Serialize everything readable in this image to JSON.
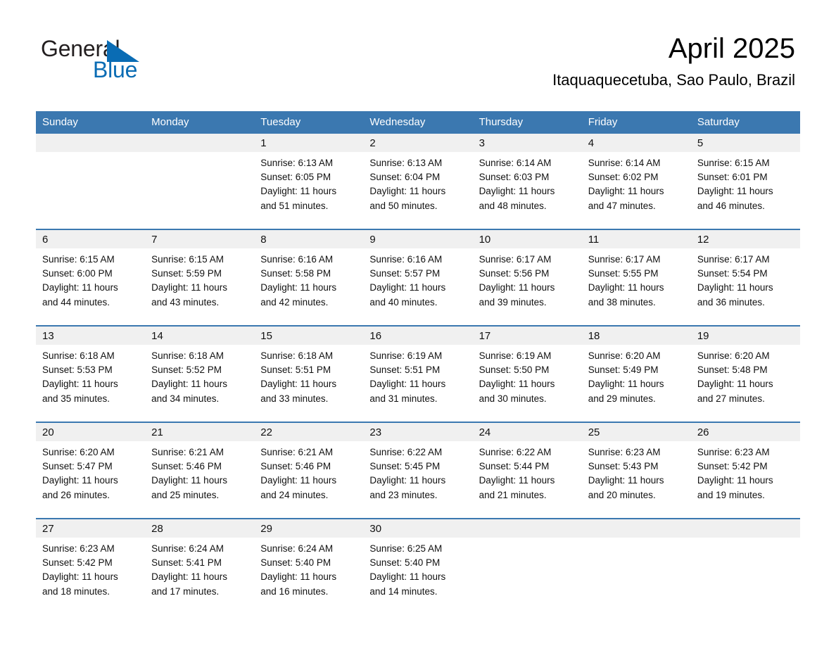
{
  "brand": {
    "name_part1": "General",
    "name_part2": "Blue",
    "triangle_color": "#0a6cb4"
  },
  "header": {
    "title": "April 2025",
    "subtitle": "Itaquaquecetuba, Sao Paulo, Brazil"
  },
  "theme": {
    "header_blue": "#3b78b0",
    "daynum_band": "#f0f0f0",
    "text": "#111111",
    "page_bg": "#ffffff"
  },
  "calendar": {
    "weekday_headers": [
      "Sunday",
      "Monday",
      "Tuesday",
      "Wednesday",
      "Thursday",
      "Friday",
      "Saturday"
    ],
    "weeks": [
      [
        {
          "day": "",
          "sunrise": "",
          "sunset": "",
          "daylight_line1": "",
          "daylight_line2": ""
        },
        {
          "day": "",
          "sunrise": "",
          "sunset": "",
          "daylight_line1": "",
          "daylight_line2": ""
        },
        {
          "day": "1",
          "sunrise": "Sunrise: 6:13 AM",
          "sunset": "Sunset: 6:05 PM",
          "daylight_line1": "Daylight: 11 hours",
          "daylight_line2": "and 51 minutes."
        },
        {
          "day": "2",
          "sunrise": "Sunrise: 6:13 AM",
          "sunset": "Sunset: 6:04 PM",
          "daylight_line1": "Daylight: 11 hours",
          "daylight_line2": "and 50 minutes."
        },
        {
          "day": "3",
          "sunrise": "Sunrise: 6:14 AM",
          "sunset": "Sunset: 6:03 PM",
          "daylight_line1": "Daylight: 11 hours",
          "daylight_line2": "and 48 minutes."
        },
        {
          "day": "4",
          "sunrise": "Sunrise: 6:14 AM",
          "sunset": "Sunset: 6:02 PM",
          "daylight_line1": "Daylight: 11 hours",
          "daylight_line2": "and 47 minutes."
        },
        {
          "day": "5",
          "sunrise": "Sunrise: 6:15 AM",
          "sunset": "Sunset: 6:01 PM",
          "daylight_line1": "Daylight: 11 hours",
          "daylight_line2": "and 46 minutes."
        }
      ],
      [
        {
          "day": "6",
          "sunrise": "Sunrise: 6:15 AM",
          "sunset": "Sunset: 6:00 PM",
          "daylight_line1": "Daylight: 11 hours",
          "daylight_line2": "and 44 minutes."
        },
        {
          "day": "7",
          "sunrise": "Sunrise: 6:15 AM",
          "sunset": "Sunset: 5:59 PM",
          "daylight_line1": "Daylight: 11 hours",
          "daylight_line2": "and 43 minutes."
        },
        {
          "day": "8",
          "sunrise": "Sunrise: 6:16 AM",
          "sunset": "Sunset: 5:58 PM",
          "daylight_line1": "Daylight: 11 hours",
          "daylight_line2": "and 42 minutes."
        },
        {
          "day": "9",
          "sunrise": "Sunrise: 6:16 AM",
          "sunset": "Sunset: 5:57 PM",
          "daylight_line1": "Daylight: 11 hours",
          "daylight_line2": "and 40 minutes."
        },
        {
          "day": "10",
          "sunrise": "Sunrise: 6:17 AM",
          "sunset": "Sunset: 5:56 PM",
          "daylight_line1": "Daylight: 11 hours",
          "daylight_line2": "and 39 minutes."
        },
        {
          "day": "11",
          "sunrise": "Sunrise: 6:17 AM",
          "sunset": "Sunset: 5:55 PM",
          "daylight_line1": "Daylight: 11 hours",
          "daylight_line2": "and 38 minutes."
        },
        {
          "day": "12",
          "sunrise": "Sunrise: 6:17 AM",
          "sunset": "Sunset: 5:54 PM",
          "daylight_line1": "Daylight: 11 hours",
          "daylight_line2": "and 36 minutes."
        }
      ],
      [
        {
          "day": "13",
          "sunrise": "Sunrise: 6:18 AM",
          "sunset": "Sunset: 5:53 PM",
          "daylight_line1": "Daylight: 11 hours",
          "daylight_line2": "and 35 minutes."
        },
        {
          "day": "14",
          "sunrise": "Sunrise: 6:18 AM",
          "sunset": "Sunset: 5:52 PM",
          "daylight_line1": "Daylight: 11 hours",
          "daylight_line2": "and 34 minutes."
        },
        {
          "day": "15",
          "sunrise": "Sunrise: 6:18 AM",
          "sunset": "Sunset: 5:51 PM",
          "daylight_line1": "Daylight: 11 hours",
          "daylight_line2": "and 33 minutes."
        },
        {
          "day": "16",
          "sunrise": "Sunrise: 6:19 AM",
          "sunset": "Sunset: 5:51 PM",
          "daylight_line1": "Daylight: 11 hours",
          "daylight_line2": "and 31 minutes."
        },
        {
          "day": "17",
          "sunrise": "Sunrise: 6:19 AM",
          "sunset": "Sunset: 5:50 PM",
          "daylight_line1": "Daylight: 11 hours",
          "daylight_line2": "and 30 minutes."
        },
        {
          "day": "18",
          "sunrise": "Sunrise: 6:20 AM",
          "sunset": "Sunset: 5:49 PM",
          "daylight_line1": "Daylight: 11 hours",
          "daylight_line2": "and 29 minutes."
        },
        {
          "day": "19",
          "sunrise": "Sunrise: 6:20 AM",
          "sunset": "Sunset: 5:48 PM",
          "daylight_line1": "Daylight: 11 hours",
          "daylight_line2": "and 27 minutes."
        }
      ],
      [
        {
          "day": "20",
          "sunrise": "Sunrise: 6:20 AM",
          "sunset": "Sunset: 5:47 PM",
          "daylight_line1": "Daylight: 11 hours",
          "daylight_line2": "and 26 minutes."
        },
        {
          "day": "21",
          "sunrise": "Sunrise: 6:21 AM",
          "sunset": "Sunset: 5:46 PM",
          "daylight_line1": "Daylight: 11 hours",
          "daylight_line2": "and 25 minutes."
        },
        {
          "day": "22",
          "sunrise": "Sunrise: 6:21 AM",
          "sunset": "Sunset: 5:46 PM",
          "daylight_line1": "Daylight: 11 hours",
          "daylight_line2": "and 24 minutes."
        },
        {
          "day": "23",
          "sunrise": "Sunrise: 6:22 AM",
          "sunset": "Sunset: 5:45 PM",
          "daylight_line1": "Daylight: 11 hours",
          "daylight_line2": "and 23 minutes."
        },
        {
          "day": "24",
          "sunrise": "Sunrise: 6:22 AM",
          "sunset": "Sunset: 5:44 PM",
          "daylight_line1": "Daylight: 11 hours",
          "daylight_line2": "and 21 minutes."
        },
        {
          "day": "25",
          "sunrise": "Sunrise: 6:23 AM",
          "sunset": "Sunset: 5:43 PM",
          "daylight_line1": "Daylight: 11 hours",
          "daylight_line2": "and 20 minutes."
        },
        {
          "day": "26",
          "sunrise": "Sunrise: 6:23 AM",
          "sunset": "Sunset: 5:42 PM",
          "daylight_line1": "Daylight: 11 hours",
          "daylight_line2": "and 19 minutes."
        }
      ],
      [
        {
          "day": "27",
          "sunrise": "Sunrise: 6:23 AM",
          "sunset": "Sunset: 5:42 PM",
          "daylight_line1": "Daylight: 11 hours",
          "daylight_line2": "and 18 minutes."
        },
        {
          "day": "28",
          "sunrise": "Sunrise: 6:24 AM",
          "sunset": "Sunset: 5:41 PM",
          "daylight_line1": "Daylight: 11 hours",
          "daylight_line2": "and 17 minutes."
        },
        {
          "day": "29",
          "sunrise": "Sunrise: 6:24 AM",
          "sunset": "Sunset: 5:40 PM",
          "daylight_line1": "Daylight: 11 hours",
          "daylight_line2": "and 16 minutes."
        },
        {
          "day": "30",
          "sunrise": "Sunrise: 6:25 AM",
          "sunset": "Sunset: 5:40 PM",
          "daylight_line1": "Daylight: 11 hours",
          "daylight_line2": "and 14 minutes."
        },
        {
          "day": "",
          "sunrise": "",
          "sunset": "",
          "daylight_line1": "",
          "daylight_line2": ""
        },
        {
          "day": "",
          "sunrise": "",
          "sunset": "",
          "daylight_line1": "",
          "daylight_line2": ""
        },
        {
          "day": "",
          "sunrise": "",
          "sunset": "",
          "daylight_line1": "",
          "daylight_line2": ""
        }
      ]
    ]
  }
}
